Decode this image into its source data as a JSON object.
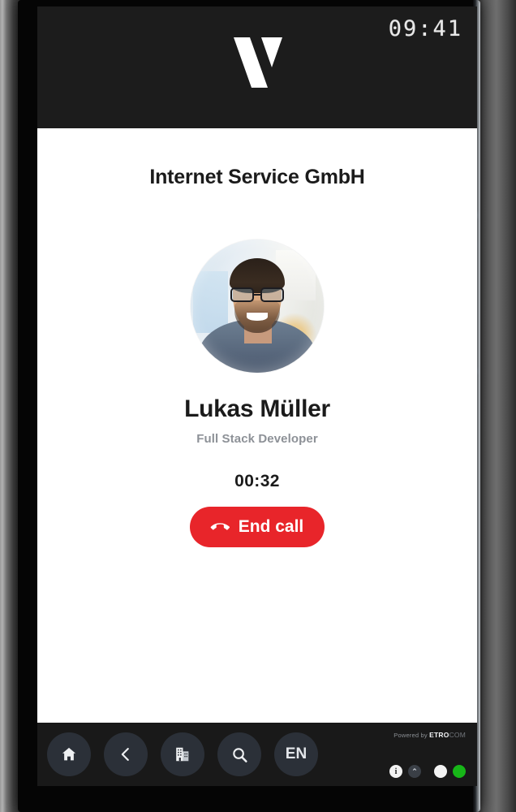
{
  "status_bar": {
    "clock": "09:41",
    "logo_name": "v-logo"
  },
  "main": {
    "company": "Internet Service GmbH",
    "person_name": "Lukas Müller",
    "person_role": "Full Stack Developer",
    "call_timer": "00:32",
    "end_call_label": "End call",
    "avatar_alt": "Lukas Müller portrait"
  },
  "bottom_nav": {
    "items": [
      {
        "name": "home",
        "icon": "home-icon",
        "label": ""
      },
      {
        "name": "back",
        "icon": "chevron-left-icon",
        "label": ""
      },
      {
        "name": "company",
        "icon": "building-icon",
        "label": ""
      },
      {
        "name": "search",
        "icon": "search-icon",
        "label": ""
      },
      {
        "name": "language",
        "icon": "language-icon",
        "label": "EN"
      }
    ],
    "brand_prefix": "Powered by ",
    "brand_name": "ETRO",
    "brand_suffix": "COM",
    "indicators": [
      {
        "name": "info",
        "glyph": "i"
      },
      {
        "name": "collapse",
        "glyph": "⌃"
      },
      {
        "name": "idle-dot",
        "glyph": ""
      },
      {
        "name": "online-dot",
        "glyph": ""
      }
    ]
  },
  "colors": {
    "accent_red": "#e8252a",
    "header_dark": "#1c1c1c",
    "nav_dark": "#191919",
    "nav_button": "#2b3038",
    "online_green": "#17b618",
    "muted_text": "#8d9197"
  }
}
